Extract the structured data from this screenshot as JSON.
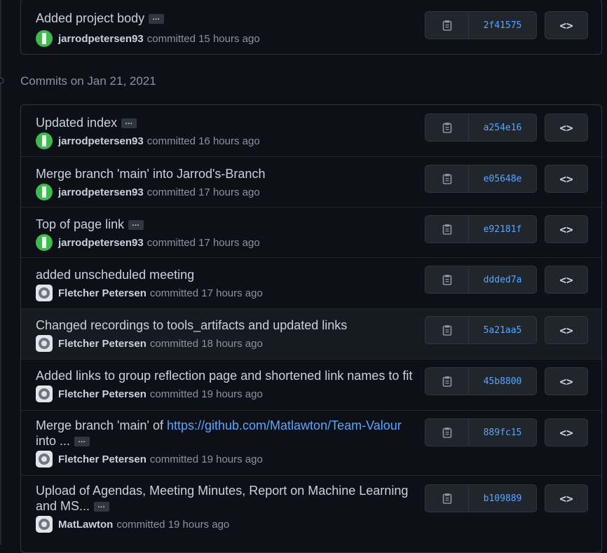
{
  "top_commit": {
    "title": "Added project body",
    "ellipsis": "…",
    "author": "jarrodpetersen93",
    "action": "committed",
    "time": "15 hours ago",
    "sha": "2f41575",
    "browse": "<>"
  },
  "date_heading": "Commits on Jan 21, 2021",
  "commits": [
    {
      "title": "Updated index",
      "ellipsis": "…",
      "author": "jarrodpetersen93",
      "action": "committed",
      "time": "16 hours ago",
      "sha": "a254e16",
      "browse": "<>"
    },
    {
      "title": "Merge branch 'main' into Jarrod's-Branch",
      "author": "jarrodpetersen93",
      "action": "committed",
      "time": "17 hours ago",
      "sha": "e05648e",
      "browse": "<>"
    },
    {
      "title": "Top of page link",
      "ellipsis": "…",
      "author": "jarrodpetersen93",
      "action": "committed",
      "time": "17 hours ago",
      "sha": "e92181f",
      "browse": "<>"
    },
    {
      "title": "added unscheduled meeting",
      "author": "Fletcher Petersen",
      "action": "committed",
      "time": "17 hours ago",
      "sha": "ddded7a",
      "browse": "<>"
    },
    {
      "title": "Changed recordings to tools_artifacts and updated links",
      "author": "Fletcher Petersen",
      "action": "committed",
      "time": "18 hours ago",
      "sha": "5a21aa5",
      "browse": "<>"
    },
    {
      "title": "Added links to group reflection page and shortened link names to fit",
      "author": "Fletcher Petersen",
      "action": "committed",
      "time": "19 hours ago",
      "sha": "45b8800",
      "browse": "<>"
    },
    {
      "title_pre": "Merge branch 'main' of ",
      "title_link": "https://github.com/Matlawton/Team-Valour",
      "title_post": "into ...",
      "ellipsis": "…",
      "author": "Fletcher Petersen",
      "action": "committed",
      "time": "19 hours ago",
      "sha": "889fc15",
      "browse": "<>"
    },
    {
      "title_line1": "Upload of Agendas, Meeting Minutes, Report on Machine Learning",
      "title_line2": "and MS...",
      "ellipsis": "…",
      "author": "MatLawton",
      "action": "committed",
      "time": "19 hours ago",
      "sha": "b109889",
      "browse": "<>"
    }
  ],
  "icons": {
    "copy": "clipboard-icon",
    "browse": "code-icon",
    "avatar_jarrod": "identicon-avatar",
    "avatar_github": "github-default-avatar"
  },
  "colors": {
    "background": "#0d1117",
    "border": "#30363d",
    "link": "#58a6ff",
    "text": "#c9d1d9",
    "muted": "#8b949e"
  }
}
